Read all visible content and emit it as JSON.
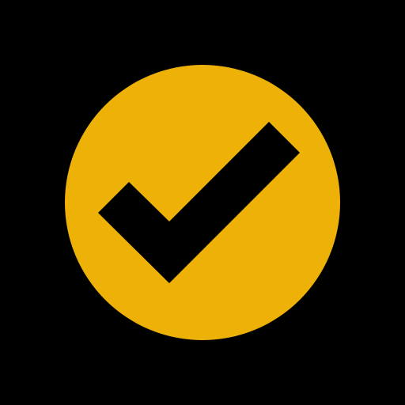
{
  "icon": {
    "name": "check-circle-icon",
    "circle_color": "#EDB108",
    "check_color": "#000000",
    "background_color": "#000000"
  }
}
